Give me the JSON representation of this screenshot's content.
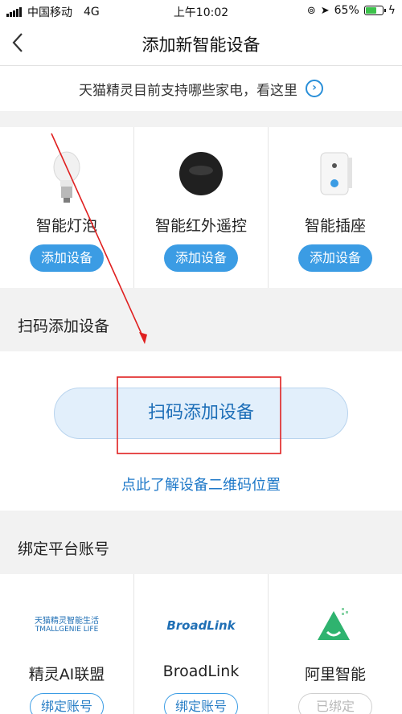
{
  "status_bar": {
    "carrier": "中国移动",
    "network": "4G",
    "time": "上午10:02",
    "battery_percent": "65%",
    "battery_level": 0.65
  },
  "nav": {
    "back_icon": "chevron-left-icon",
    "title": "添加新智能设备"
  },
  "banner": {
    "text": "天猫精灵目前支持哪些家电，看这里",
    "arrow_icon": "circle-arrow-right-icon"
  },
  "devices": [
    {
      "name": "智能灯泡",
      "button": "添加设备",
      "icon": "light-bulb-icon"
    },
    {
      "name": "智能红外遥控",
      "button": "添加设备",
      "icon": "ir-remote-icon"
    },
    {
      "name": "智能插座",
      "button": "添加设备",
      "icon": "smart-plug-icon"
    }
  ],
  "scan_section": {
    "heading": "扫码添加设备",
    "button": "扫码添加设备",
    "link": "点此了解设备二维码位置"
  },
  "bind_section": {
    "heading": "绑定平台账号"
  },
  "platforms": [
    {
      "name": "精灵AI联盟",
      "button": "绑定账号",
      "logo_line1": "天猫精灵智能生活",
      "logo_line2": "TMALLGENIE LIFE"
    },
    {
      "name": "BroadLink",
      "button": "绑定账号",
      "logo_text": "BroadLink"
    },
    {
      "name": "阿里智能",
      "button": "已绑定",
      "logo_icon": "ali-smart-logo-icon"
    }
  ],
  "colors": {
    "accent": "#3b9ce4",
    "link": "#1e78c8",
    "annotation": "#e02020"
  }
}
